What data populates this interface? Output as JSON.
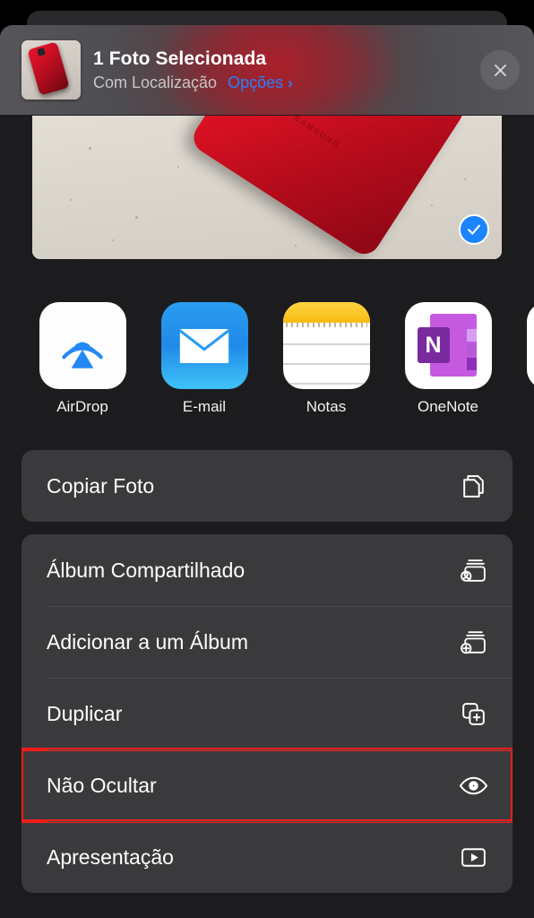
{
  "header": {
    "title": "1 Foto Selecionada",
    "subtitle": "Com Localização",
    "options_label": "Opções",
    "options_chevron": "›",
    "close_icon": "close-icon",
    "thumbnail_icon": "photo-thumbnail"
  },
  "preview": {
    "brand_text": "SAMSUNG",
    "selected_badge_icon": "checkmark-circle-icon",
    "selected": true
  },
  "apps": [
    {
      "label": "AirDrop",
      "icon": "airdrop-icon"
    },
    {
      "label": "E-mail",
      "icon": "mail-icon"
    },
    {
      "label": "Notas",
      "icon": "notes-icon"
    },
    {
      "label": "OneNote",
      "icon": "onenote-icon",
      "letter": "N"
    },
    {
      "label": "",
      "icon": "google-drive-icon"
    }
  ],
  "copy_group": [
    {
      "label": "Copiar Foto",
      "icon": "copy-icon",
      "highlighted": false
    }
  ],
  "actions": [
    {
      "label": "Álbum Compartilhado",
      "icon": "shared-album-icon",
      "highlighted": false
    },
    {
      "label": "Adicionar a um Álbum",
      "icon": "add-to-album-icon",
      "highlighted": false
    },
    {
      "label": "Duplicar",
      "icon": "duplicate-icon",
      "highlighted": false
    },
    {
      "label": "Não Ocultar",
      "icon": "eye-icon",
      "highlighted": true
    },
    {
      "label": "Apresentação",
      "icon": "slideshow-icon",
      "highlighted": false
    }
  ],
  "colors": {
    "accent_blue": "#2f7dfb",
    "highlight_red": "#f51b1b",
    "sheet_background": "#1c1c1e",
    "panel_background": "#3a3a3c",
    "check_blue": "#1b84ff"
  }
}
